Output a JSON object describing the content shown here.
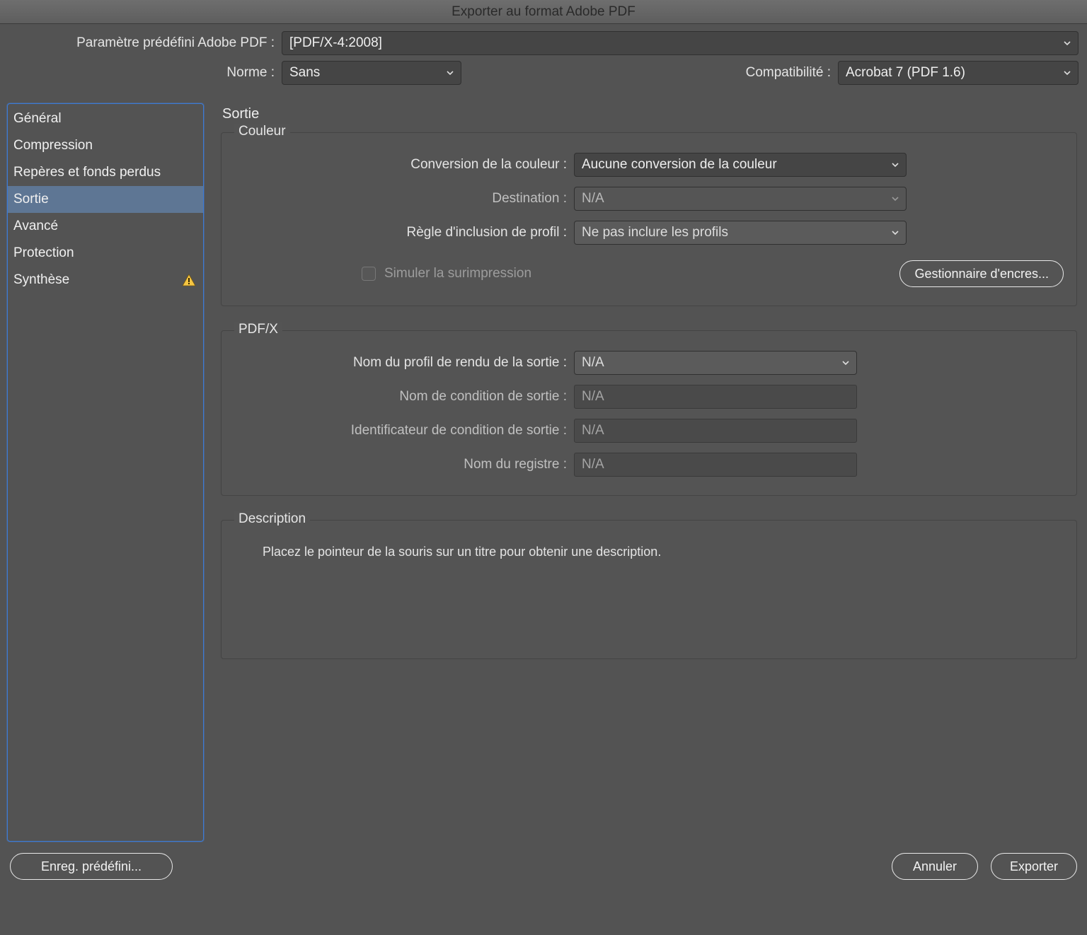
{
  "window": {
    "title": "Exporter au format Adobe PDF"
  },
  "top": {
    "presetLabel": "Paramètre prédéfini Adobe PDF :",
    "presetValue": "[PDF/X-4:2008]",
    "standardLabel": "Norme  :",
    "standardValue": "Sans",
    "compatLabel": "Compatibilité :",
    "compatValue": "Acrobat 7 (PDF 1.6)"
  },
  "sidebar": {
    "items": [
      {
        "label": "Général"
      },
      {
        "label": "Compression"
      },
      {
        "label": "Repères et fonds perdus"
      },
      {
        "label": "Sortie"
      },
      {
        "label": "Avancé"
      },
      {
        "label": "Protection"
      },
      {
        "label": "Synthèse",
        "warning": true
      }
    ],
    "selectedIndex": 3
  },
  "panel": {
    "title": "Sortie",
    "color": {
      "legend": "Couleur",
      "conversionLabel": "Conversion de la couleur :",
      "conversionValue": "Aucune conversion de la couleur",
      "destinationLabel": "Destination :",
      "destinationValue": "N/A",
      "policyLabel": "Règle d'inclusion de profil :",
      "policyValue": "Ne pas inclure les profils",
      "simulateLabel": "Simuler la surimpression",
      "inkManager": "Gestionnaire d'encres..."
    },
    "pdfx": {
      "legend": "PDF/X",
      "outputProfileLabel": "Nom du profil de rendu de la sortie :",
      "outputProfileValue": "N/A",
      "conditionNameLabel": "Nom de condition de sortie :",
      "conditionNameValue": "N/A",
      "conditionIdLabel": "Identificateur de condition de sortie :",
      "conditionIdValue": "N/A",
      "registryLabel": "Nom du registre :",
      "registryValue": "N/A"
    },
    "description": {
      "legend": "Description",
      "text": "Placez le pointeur de la souris sur un titre pour obtenir une description."
    }
  },
  "footer": {
    "savePreset": "Enreg. prédéfini...",
    "cancel": "Annuler",
    "export": "Exporter"
  }
}
